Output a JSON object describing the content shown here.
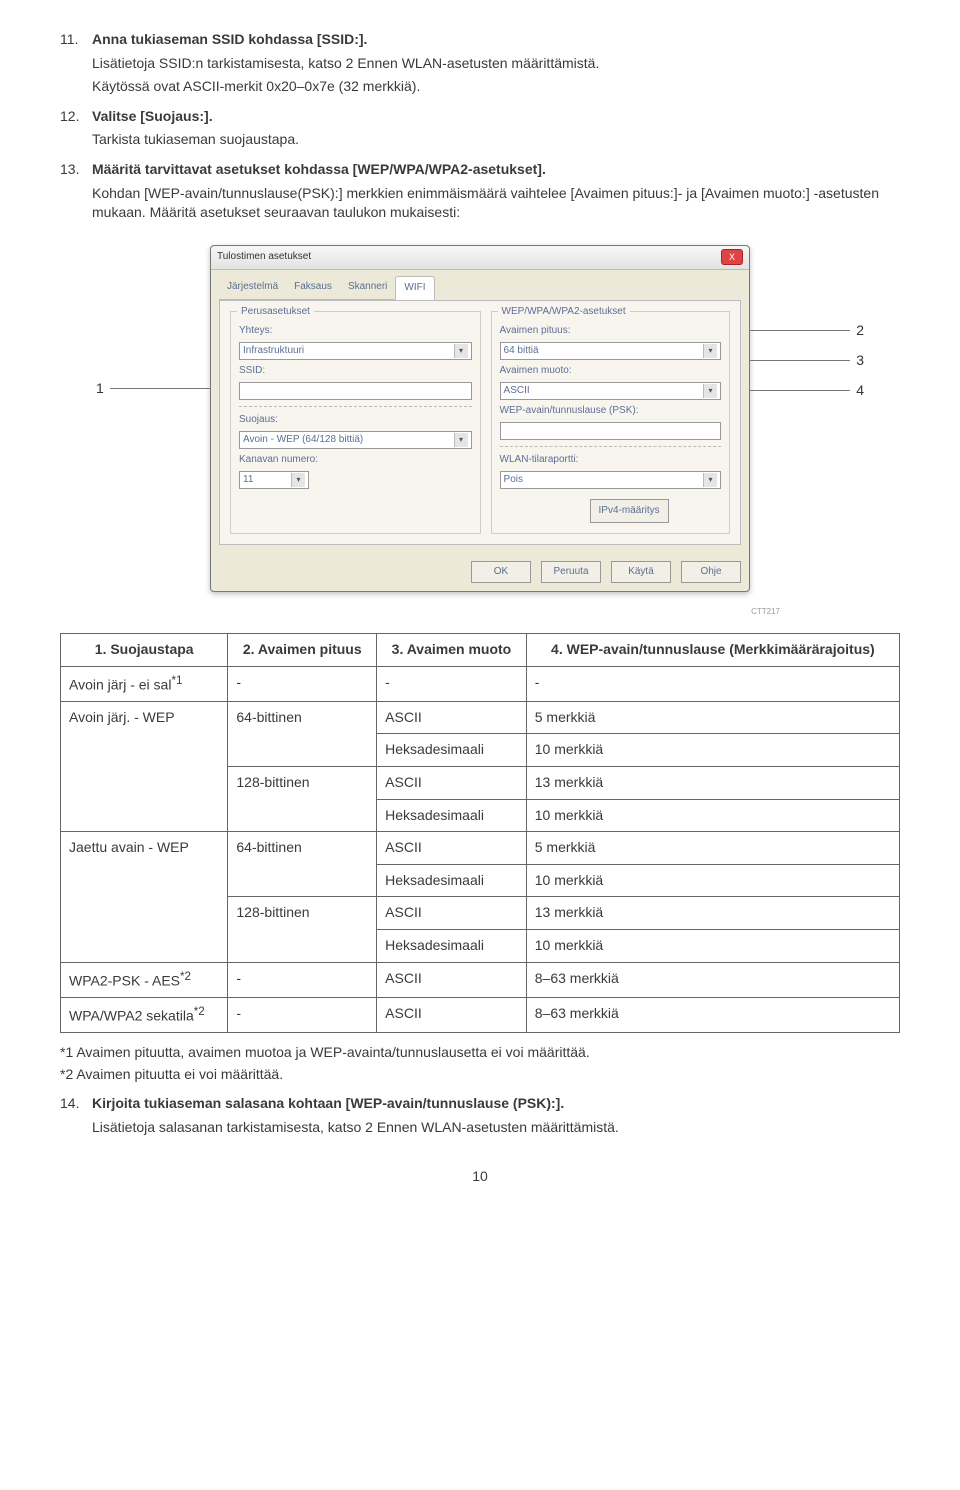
{
  "step11": {
    "num": "11.",
    "title": "Anna tukiaseman SSID kohdassa [SSID:].",
    "para1": "Lisätietoja SSID:n tarkistamisesta, katso 2 Ennen WLAN-asetusten määrittämistä.",
    "para2": "Käytössä ovat ASCII-merkit 0x20–0x7e (32 merkkiä)."
  },
  "step12": {
    "num": "12.",
    "title": "Valitse [Suojaus:].",
    "para1": "Tarkista tukiaseman suojaustapa."
  },
  "step13": {
    "num": "13.",
    "title": "Määritä tarvittavat asetukset kohdassa [WEP/WPA/WPA2-asetukset].",
    "para1": "Kohdan [WEP-avain/tunnuslause(PSK):] merkkien enimmäismäärä vaihtelee [Avaimen pituus:]- ja [Avaimen muoto:] -asetusten mukaan. Määritä asetukset seuraavan taulukon mukaisesti:"
  },
  "dlg": {
    "title": "Tulostimen asetukset",
    "close": "X",
    "tabs": [
      "Järjestelmä",
      "Faksaus",
      "Skanneri",
      "WIFI"
    ],
    "tab_active": "WIFI",
    "fs1": {
      "legend": "Perusasetukset",
      "f_yhteys": "Yhteys:",
      "v_yhteys": "Infrastruktuuri",
      "f_ssid": "SSID:",
      "v_ssid": "",
      "f_suojaus": "Suojaus:",
      "v_suojaus": "Avoin - WEP (64/128 bittiä)",
      "f_kanava": "Kanavan numero:",
      "v_kanava": "11"
    },
    "fs2": {
      "legend": "WEP/WPA/WPA2-asetukset",
      "f_pituus": "Avaimen pituus:",
      "v_pituus": "64 bittiä",
      "f_muoto": "Avaimen muoto:",
      "v_muoto": "ASCII",
      "f_psk": "WEP-avain/tunnuslause (PSK):",
      "v_psk": ""
    },
    "wlan_label": "WLAN-tilaraportti:",
    "wlan_val": "Pois",
    "ipv4": "IPv4-määritys",
    "btn_ok": "OK",
    "btn_cancel": "Peruuta",
    "btn_apply": "Käytä",
    "btn_help": "Ohje"
  },
  "callouts": {
    "c1": "1",
    "c2": "2",
    "c3": "3",
    "c4": "4"
  },
  "fig_id": "CTT217",
  "table": {
    "h1": "1. Suojaustapa",
    "h2": "2. Avaimen pituus",
    "h3": "3. Avaimen muoto",
    "h4": "4. WEP-avain/tunnuslause (Merkkimäärärajoitus)",
    "rows": [
      {
        "c1": "Avoin järj - ei sal",
        "sup1": "*1",
        "c2": "-",
        "c3": "-",
        "c4": "-"
      },
      {
        "c1": "Avoin järj. - WEP",
        "c2": "64-bittinen",
        "c3": "ASCII",
        "c4": "5 merkkiä"
      },
      {
        "c3": "Heksadesimaali",
        "c4": "10 merkkiä"
      },
      {
        "c2": "128-bittinen",
        "c3": "ASCII",
        "c4": "13 merkkiä"
      },
      {
        "c3": "Heksadesimaali",
        "c4": "10 merkkiä"
      },
      {
        "c1": "Jaettu avain - WEP",
        "c2": "64-bittinen",
        "c3": "ASCII",
        "c4": "5 merkkiä"
      },
      {
        "c3": "Heksadesimaali",
        "c4": "10 merkkiä"
      },
      {
        "c2": "128-bittinen",
        "c3": "ASCII",
        "c4": "13 merkkiä"
      },
      {
        "c3": "Heksadesimaali",
        "c4": "10 merkkiä"
      },
      {
        "c1": "WPA2-PSK - AES",
        "sup1": "*2",
        "c2": "-",
        "c3": "ASCII",
        "c4": "8–63 merkkiä"
      },
      {
        "c1": "WPA/WPA2 sekatila",
        "sup1": "*2",
        "c2": "-",
        "c3": "ASCII",
        "c4": "8–63 merkkiä"
      }
    ]
  },
  "footnote1": "*1 Avaimen pituutta, avaimen muotoa ja WEP-avainta/tunnuslausetta ei voi määrittää.",
  "footnote2": "*2 Avaimen pituutta ei voi määrittää.",
  "step14": {
    "num": "14.",
    "title": "Kirjoita tukiaseman salasana kohtaan [WEP-avain/tunnuslause (PSK):].",
    "para1": "Lisätietoja salasanan tarkistamisesta, katso 2 Ennen WLAN-asetusten määrittämistä."
  },
  "page_number": "10"
}
